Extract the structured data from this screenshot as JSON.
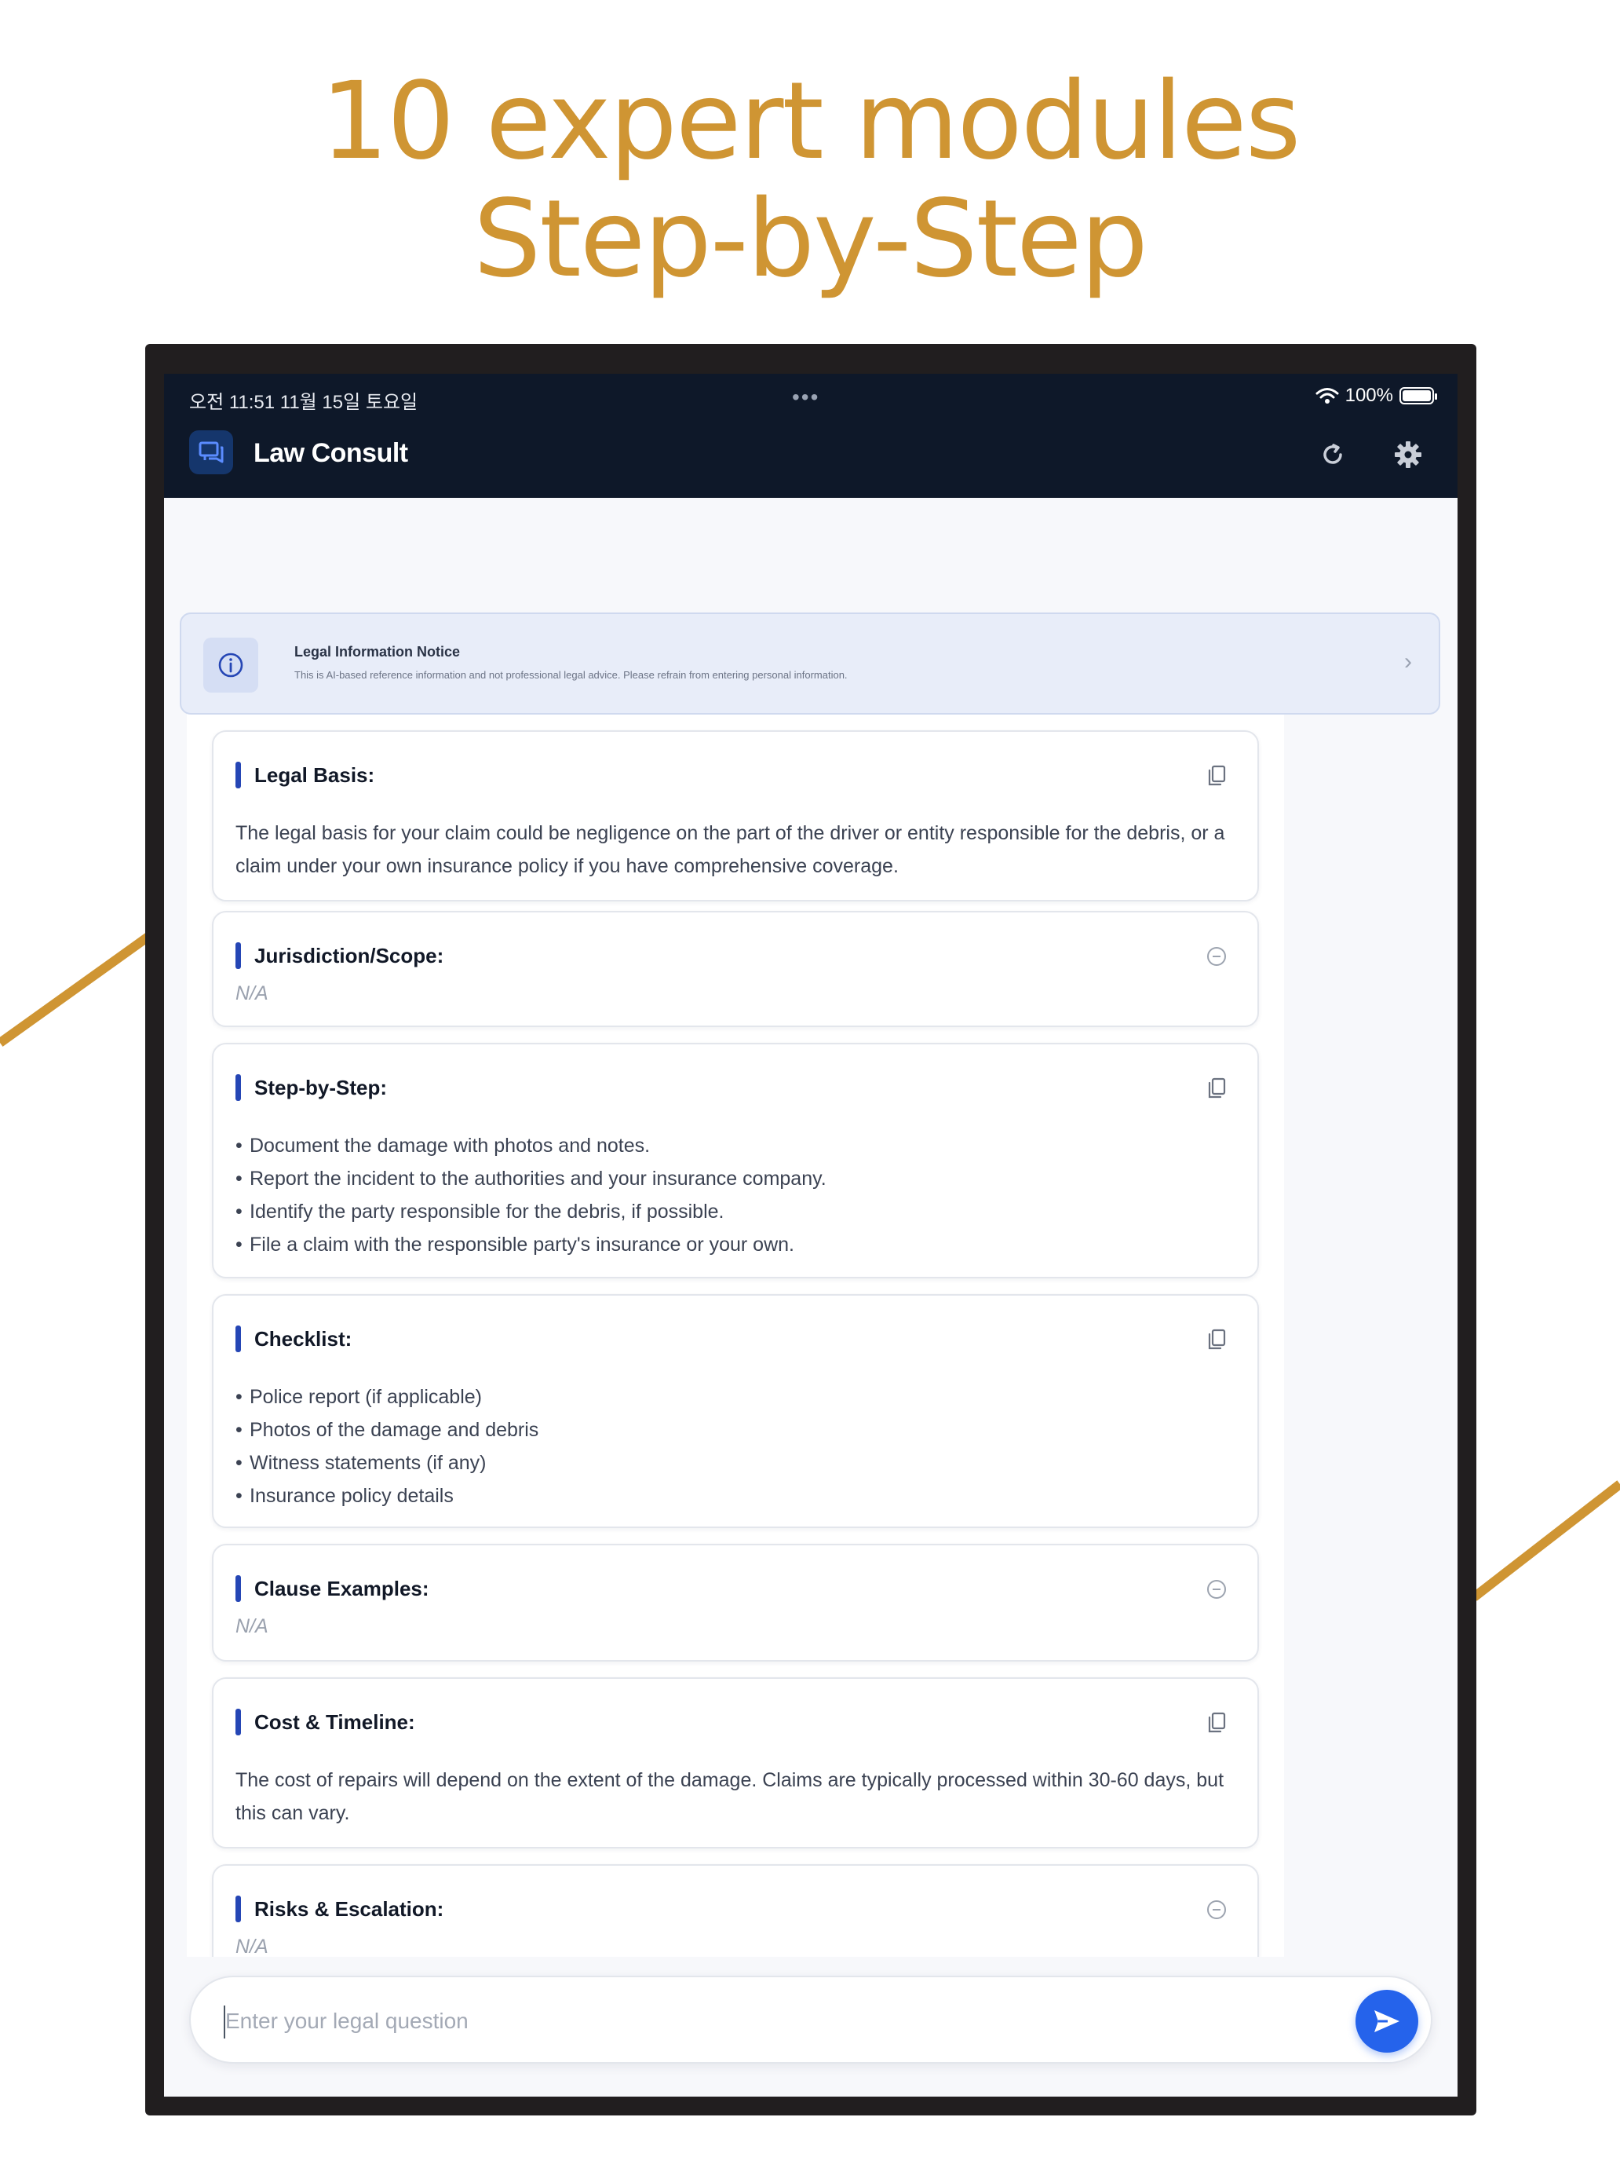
{
  "headline": {
    "line1": "10 expert modules",
    "line2": "Step-by-Step"
  },
  "status_bar": {
    "time_date": "오전 11:51   11월 15일 토요일",
    "dots": "•••",
    "battery": "100%"
  },
  "app": {
    "title": "Law Consult"
  },
  "notice": {
    "title": "Legal Information Notice",
    "text": "This is AI-based reference information and not professional legal advice. Please refrain from entering personal information.",
    "chevron": "›"
  },
  "sections": [
    {
      "title": "Legal Basis:",
      "action": "copy",
      "body": "The legal basis for your claim could be negligence on the part of the driver or entity responsible for the debris, or a claim under your own insurance policy if you have comprehensive coverage."
    },
    {
      "title": "Jurisdiction/Scope:",
      "action": "collapse",
      "body": "N/A"
    },
    {
      "title": "Step-by-Step:",
      "action": "copy",
      "items": [
        "Document the damage with photos and notes.",
        "Report the incident to the authorities and your insurance company.",
        "Identify the party responsible for the debris, if possible.",
        "File a claim with the responsible party's insurance or your own."
      ]
    },
    {
      "title": "Checklist:",
      "action": "copy",
      "items": [
        "Police report (if applicable)",
        "Photos of the damage and debris",
        "Witness statements (if any)",
        "Insurance policy details"
      ]
    },
    {
      "title": "Clause Examples:",
      "action": "collapse",
      "body": "N/A"
    },
    {
      "title": "Cost & Timeline:",
      "action": "copy",
      "body": "The cost of repairs will depend on the extent of the damage. Claims are typically processed within 30-60 days, but this can vary."
    },
    {
      "title": "Risks & Escalation:",
      "action": "collapse",
      "body": "N/A"
    }
  ],
  "input": {
    "placeholder": "Enter your legal question"
  },
  "colors": {
    "gold": "#cf9533",
    "header": "#0e1829",
    "accent": "#2546b5",
    "send": "#2563eb"
  },
  "icons": {
    "logo": "chat-bubbles-icon",
    "refresh": "refresh-icon",
    "settings": "gear-icon",
    "notice": "info-icon",
    "copy": "copy-icon",
    "collapse": "minus-circle-icon",
    "send": "send-icon"
  }
}
